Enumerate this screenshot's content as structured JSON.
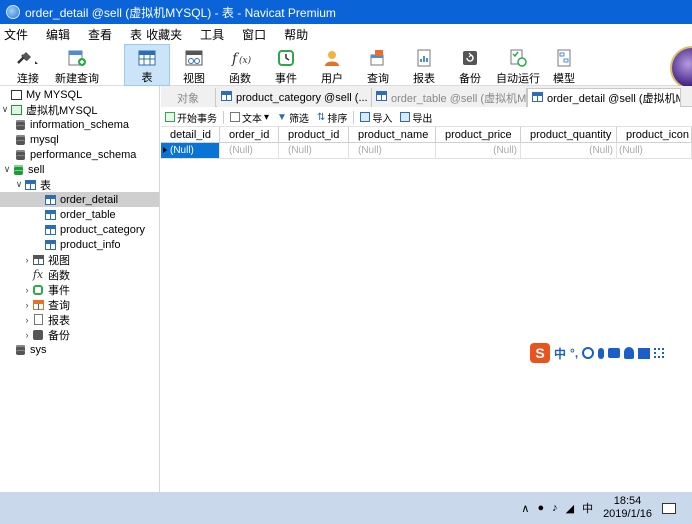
{
  "window": {
    "title": "order_detail @sell (虚拟机MYSQL) - 表 - Navicat Premium"
  },
  "menu": [
    "文件",
    "编辑",
    "查看",
    "表",
    "收藏夹",
    "工具",
    "窗口",
    "帮助"
  ],
  "toolbar": {
    "connect": "连接",
    "new_query": "新建查询",
    "table": "表",
    "view": "视图",
    "function": "函数",
    "event": "事件",
    "user": "用户",
    "query": "查询",
    "report": "报表",
    "backup": "备份",
    "automation": "自动运行",
    "model": "模型"
  },
  "tree": {
    "my_mysql": "My MYSQL",
    "vm_mysql": "虚拟机MYSQL",
    "db_information_schema": "information_schema",
    "db_mysql": "mysql",
    "db_performance_schema": "performance_schema",
    "db_sell": "sell",
    "tables_group": "表",
    "tables": [
      "order_detail",
      "order_table",
      "product_category",
      "product_info"
    ],
    "views": "视图",
    "functions": "函数",
    "events": "事件",
    "queries": "查询",
    "reports": "报表",
    "backups": "备份",
    "db_sys": "sys"
  },
  "tabs": {
    "objects": "对象",
    "tab1": "product_category @sell (...",
    "tab2": "order_table @sell (虚拟机M...",
    "tab3": "order_detail @sell (虚拟机M..."
  },
  "subtoolbar": {
    "begin_transaction": "开始事务",
    "text": "文本",
    "filter": "筛选",
    "sort": "排序",
    "import": "导入",
    "export": "导出"
  },
  "grid": {
    "columns": [
      "detail_id",
      "order_id",
      "product_id",
      "product_name",
      "product_price",
      "product_quantity",
      "product_icon"
    ],
    "row": [
      "(Null)",
      "(Null)",
      "(Null)",
      "(Null)",
      "(Null)",
      "(Null)",
      "(Null)"
    ]
  },
  "ime": {
    "text": "中",
    "punct": "°,"
  },
  "taskbar": {
    "ime_lang": "中",
    "time": "18:54",
    "date": "2019/1/16"
  },
  "colors": {
    "titlebar": "#0a64d8",
    "selection": "#0a74d6",
    "taskbar": "#c9d8ea"
  }
}
